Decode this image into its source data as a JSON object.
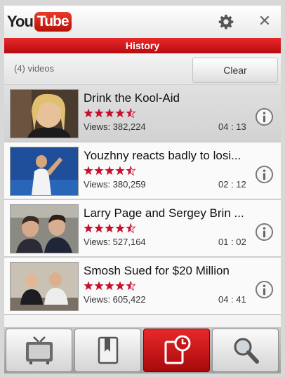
{
  "app": {
    "logo_you": "You",
    "logo_tube": "Tube"
  },
  "header": {
    "title": "History"
  },
  "subbar": {
    "count": "(4) videos",
    "clear_label": "Clear"
  },
  "videos": [
    {
      "title": "Drink the Kool-Aid",
      "views": "Views: 382,224",
      "duration": "04 : 13",
      "rating": 4.5
    },
    {
      "title": "Youzhny reacts badly to losi...",
      "views": "Views: 380,259",
      "duration": "02 : 12",
      "rating": 4.5
    },
    {
      "title": "Larry Page and Sergey Brin ...",
      "views": "Views: 527,164",
      "duration": "01 : 02",
      "rating": 4.5
    },
    {
      "title": "Smosh Sued for $20 Million",
      "views": "Views: 605,422",
      "duration": "04 : 41",
      "rating": 4.5
    }
  ],
  "nav": [
    "tv-icon",
    "bookmark-icon",
    "history-icon",
    "search-icon"
  ],
  "colors": {
    "accent": "#d11a1e",
    "star": "#c8102e"
  }
}
